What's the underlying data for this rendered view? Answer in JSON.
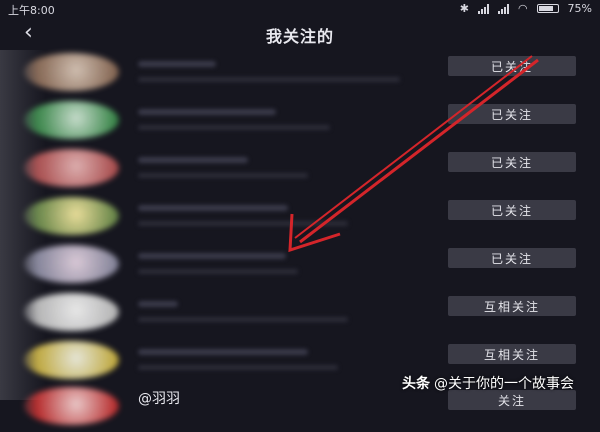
{
  "status_bar": {
    "time": "上午8:00",
    "battery": "75%"
  },
  "header": {
    "title": "我关注的"
  },
  "colors": {
    "background": "#16161f",
    "button_bg": "#3a3a45",
    "arrow": "#d4252a"
  },
  "list": [
    {
      "button": "已关注",
      "avatar_colors": [
        "#d9c7b8",
        "#8a6a55"
      ]
    },
    {
      "button": "已关注",
      "avatar_colors": [
        "#cfe6d4",
        "#3a8a4a"
      ]
    },
    {
      "button": "已关注",
      "avatar_colors": [
        "#e7b6b6",
        "#b05050"
      ]
    },
    {
      "button": "已关注",
      "avatar_colors": [
        "#f3e7a0",
        "#6a8a4a"
      ]
    },
    {
      "button": "已关注",
      "avatar_colors": [
        "#e3d2e0",
        "#8a8aa0"
      ]
    },
    {
      "button": "互相关注",
      "avatar_colors": [
        "#f2f2f2",
        "#bdbdbd"
      ]
    },
    {
      "button": "互相关注",
      "avatar_colors": [
        "#f0f0e0",
        "#c8b040"
      ]
    },
    {
      "button": "关注",
      "name": "@羽羽",
      "avatar_colors": [
        "#f4d0d0",
        "#c03030"
      ]
    }
  ],
  "watermark": {
    "brand": "头条",
    "text": "@关于你的一个故事会"
  }
}
